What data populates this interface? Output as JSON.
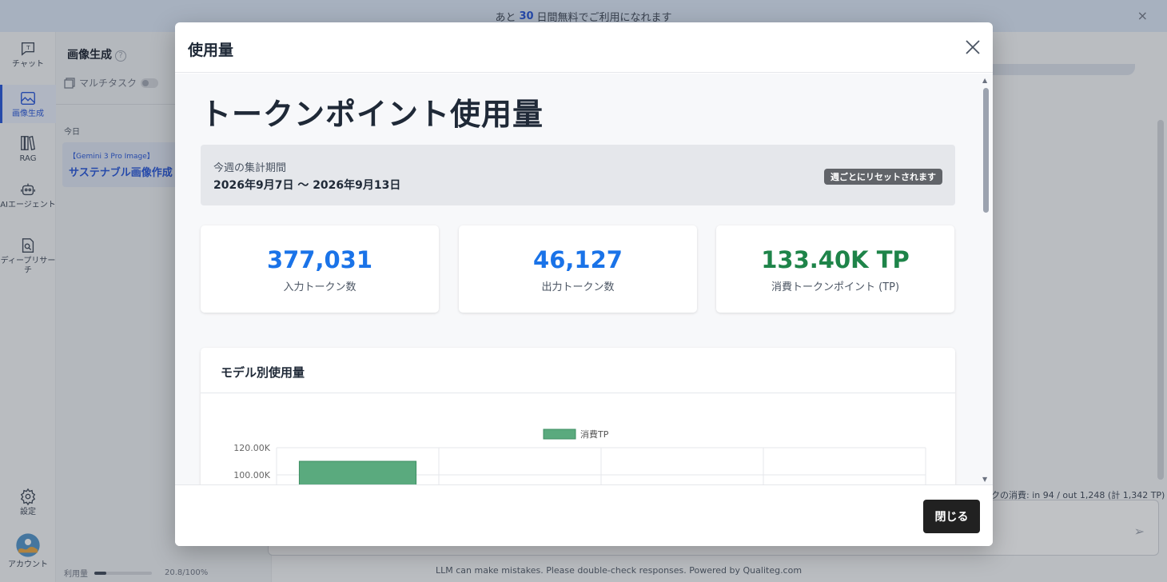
{
  "banner": {
    "prefix": "あと",
    "days": "30",
    "suffix": "日間無料でご利用になれます",
    "close_icon": "×"
  },
  "rail": {
    "items": [
      {
        "label": "チャット",
        "icon": "chat-icon"
      },
      {
        "label": "画像生成",
        "icon": "image-icon"
      },
      {
        "label": "RAG",
        "icon": "books-icon"
      },
      {
        "label": "AIエージェント",
        "icon": "robot-icon"
      },
      {
        "label": "ディープリサーチ",
        "icon": "search-doc-icon"
      }
    ],
    "settings_label": "設定",
    "account_label": "アカウント"
  },
  "history": {
    "title": "画像生成",
    "help": "?",
    "multitask_label": "マルチタスク",
    "today_label": "今日",
    "item_tag": "【Gemini 3 Pro Image】",
    "item_name": "サステナブル画像作成"
  },
  "main": {
    "consumption_text": "クの消費: in 94 / out 1,248 (計 1,342 TP)",
    "send_icon": "➢"
  },
  "bottombar": {
    "usage_label": "利用量",
    "usage_value": "20.8/100%",
    "usage_fraction": 0.208,
    "disclaimer": "LLM can make mistakes. Please double-check responses. Powered by Qualiteg.com"
  },
  "modal": {
    "title": "使用量",
    "heading": "トークンポイント使用量",
    "period_label": "今週の集計期間",
    "period_range": "2026年9月7日 〜 2026年9月13日",
    "reset_badge": "週ごとにリセットされます",
    "stats": [
      {
        "value": "377,031",
        "caption": "入力トークン数",
        "color": "#1a73e8"
      },
      {
        "value": "46,127",
        "caption": "出力トークン数",
        "color": "#1a73e8"
      },
      {
        "value": "133.40K TP",
        "caption": "消費トークンポイント (TP)",
        "color": "#1e8449"
      }
    ],
    "chart_section_title": "モデル別使用量",
    "close_button": "閉じる"
  },
  "chart_data": {
    "type": "bar",
    "series": [
      {
        "name": "消費TP",
        "values": [
          110000,
          null,
          null,
          null
        ],
        "color": "#5aaa7e"
      }
    ],
    "yticks": [
      "120.00K",
      "100.00K"
    ],
    "visible_ylim": [
      100000,
      120000
    ]
  }
}
